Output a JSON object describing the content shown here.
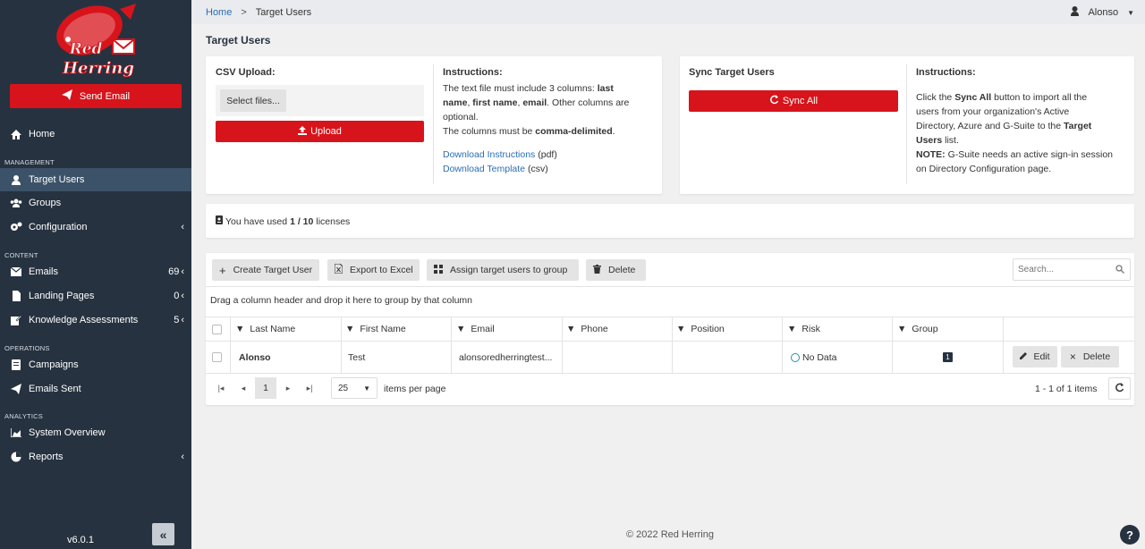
{
  "brand": {
    "name_line1": "Red",
    "name_line2": "Herring",
    "accent": "#d7141b",
    "sidebar_bg": "#263240"
  },
  "sidebar": {
    "send_email": "Send Email",
    "home": "Home",
    "sections": {
      "management": "MANAGEMENT",
      "content": "CONTENT",
      "operations": "OPERATIONS",
      "analytics": "ANALYTICS"
    },
    "items": {
      "target_users": "Target Users",
      "groups": "Groups",
      "configuration": "Configuration",
      "emails": "Emails",
      "emails_count": "69",
      "landing_pages": "Landing Pages",
      "landing_pages_count": "0",
      "knowledge": "Knowledge Assessments",
      "knowledge_count": "5",
      "campaigns": "Campaigns",
      "emails_sent": "Emails Sent",
      "system_overview": "System Overview",
      "reports": "Reports"
    },
    "version": "v6.0.1",
    "collapse": "«"
  },
  "topbar": {
    "home": "Home",
    "separator": ">",
    "current": "Target Users",
    "user": "Alonso"
  },
  "page_title": "Target Users",
  "csv": {
    "title": "CSV Upload:",
    "select_files": "Select files...",
    "upload": "Upload",
    "instructions_title": "Instructions:",
    "line1a": "The text file must include 3 columns: ",
    "line1b": "last",
    "line2a": "name",
    "line2b": ", ",
    "line2c": "first name",
    "line2d": ", ",
    "line2e": "email",
    "line2f": ". Other columns are",
    "line3": "optional.",
    "line4a": "The columns must be ",
    "line4b": "comma-delimited",
    "line4c": ".",
    "download_instructions": "Download Instructions",
    "pdf": " (pdf)",
    "download_template": "Download Template",
    "csv": " (csv)"
  },
  "sync": {
    "title": "Sync Target Users",
    "button": "Sync All",
    "instructions_title": "Instructions:",
    "l1a": "Click the ",
    "l1b": "Sync All",
    "l1c": " button to import all the",
    "l2": "users from your organization's Active",
    "l3a": "Directory, Azure and G-Suite to the ",
    "l3b": "Target",
    "l4a": "Users",
    "l4b": " list.",
    "l5a": "NOTE:",
    "l5b": " G-Suite needs an active sign-in session",
    "l6": "on Directory Configuration page."
  },
  "license": {
    "prefix": "You have used ",
    "used": "1 / 10",
    "suffix": " licenses"
  },
  "toolbar": {
    "create": "Create Target User",
    "export": "Export to Excel",
    "assign": "Assign target users to group",
    "delete": "Delete",
    "search_placeholder": "Search..."
  },
  "group_hint": "Drag a column header and drop it here to group by that column",
  "columns": [
    "Last Name",
    "First Name",
    "Email",
    "Phone",
    "Position",
    "Risk",
    "Group"
  ],
  "rows": [
    {
      "last_name": "Alonso",
      "first_name": "Test",
      "email": "alonsoredherringtest...",
      "phone": "",
      "position": "",
      "risk": "No Data",
      "group": "1",
      "edit": "Edit",
      "delete": "Delete"
    }
  ],
  "pager": {
    "page": "1",
    "page_size": "25",
    "items_per_page": "items per page",
    "summary": "1 - 1 of 1 items"
  },
  "footer": "© 2022 Red Herring",
  "help": "?"
}
